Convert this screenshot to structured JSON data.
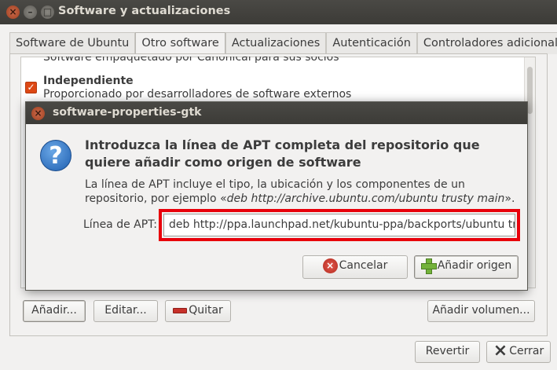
{
  "window": {
    "title": "Software y actualizaciones",
    "close_glyph": "×",
    "min_glyph": "–",
    "max_glyph": "□"
  },
  "tabs": [
    {
      "label": "Software de Ubuntu"
    },
    {
      "label": "Otro software"
    },
    {
      "label": "Actualizaciones"
    },
    {
      "label": "Autenticación"
    },
    {
      "label": "Controladores adicionales"
    }
  ],
  "list": {
    "cutoff_text": "Software empaquetado por Canonical para sus socios",
    "item": {
      "checked": true,
      "check_glyph": "✓",
      "title": "Independiente",
      "description": "Proporcionado por desarrolladores de software externos"
    }
  },
  "bottom_buttons": {
    "add": "Añadir...",
    "edit": "Editar...",
    "remove": "Quitar",
    "add_volume": "Añadir volumen...",
    "revert": "Revertir",
    "close": "Cerrar"
  },
  "dialog": {
    "title": "software-properties-gtk",
    "close_glyph": "×",
    "question_glyph": "?",
    "heading": "Introduzca la línea de APT completa del repositorio que quiere añadir como origen de software",
    "body_prefix": "La línea de APT incluye el tipo, la ubicación y los componentes de un repositorio, por ejemplo «",
    "body_example": "deb http://archive.ubuntu.com/ubuntu trusty main",
    "body_suffix": "».",
    "apt_label": "Línea de APT:",
    "apt_value": "deb http://ppa.launchpad.net/kubuntu-ppa/backports/ubuntu trusty main",
    "cancel_label": "Cancelar",
    "cancel_glyph": "×",
    "add_label": "Añadir origen"
  },
  "colors": {
    "highlight": "#e8000b",
    "checkbox": "#dd4814"
  }
}
